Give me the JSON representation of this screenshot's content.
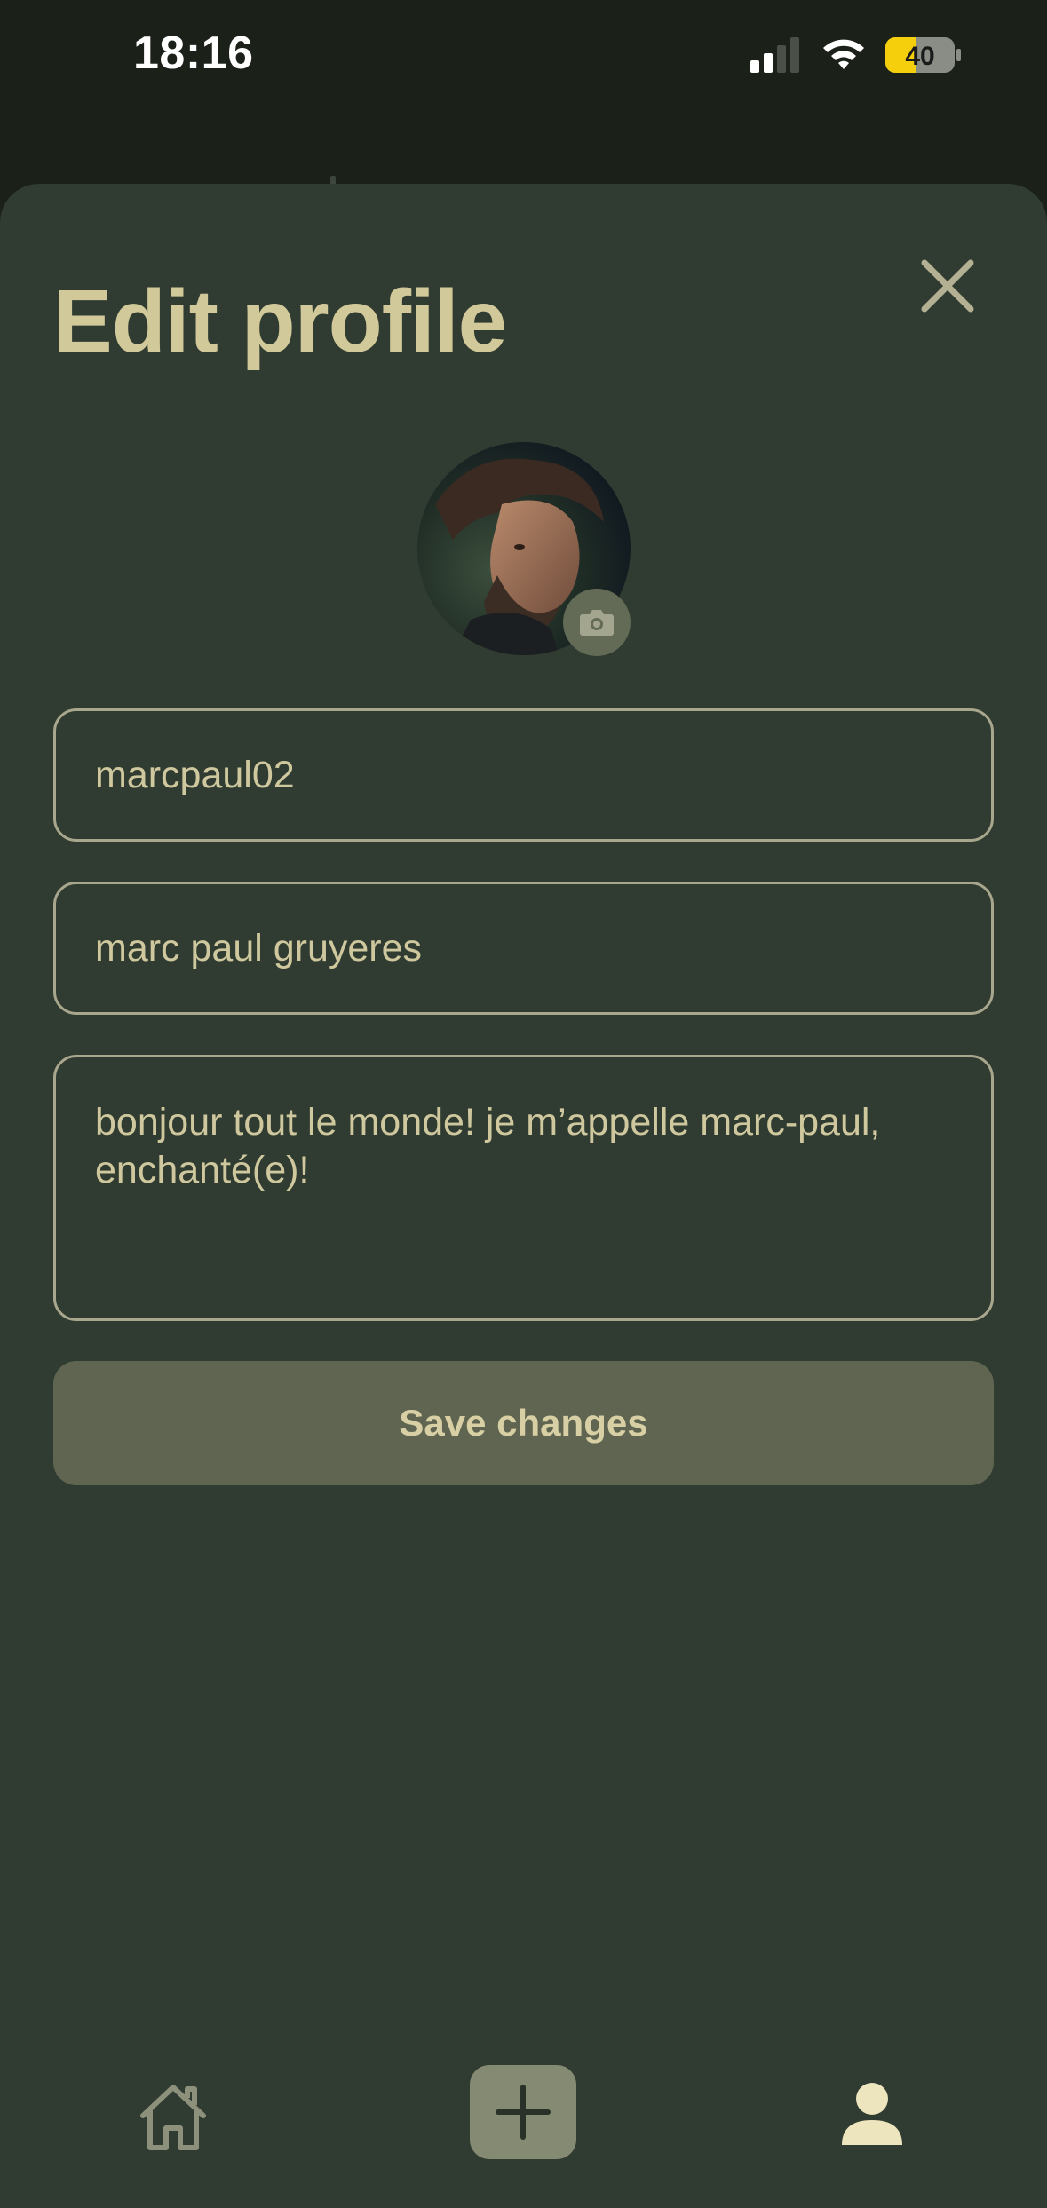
{
  "status_bar": {
    "time": "18:16",
    "battery_level": "40",
    "signal_bars_active": 2,
    "signal_bars_total": 4
  },
  "header": {
    "title": "Edit profile",
    "close_icon": "close-icon"
  },
  "avatar": {
    "badge_icon": "camera-icon"
  },
  "form": {
    "username_value": "marcpaul02",
    "name_value": "marc paul gruyeres",
    "bio_value": "bonjour tout le monde! je m’appelle marc-paul, enchanté(e)!",
    "save_label": "Save changes"
  },
  "bottom_nav": {
    "items": [
      {
        "icon": "home-icon",
        "active": false
      },
      {
        "icon": "plus-icon",
        "active": false
      },
      {
        "icon": "profile-icon",
        "active": true
      }
    ]
  },
  "colors": {
    "background": "#1b2019",
    "sheet": "#303c31",
    "accent_text": "#d2c99a",
    "field_border": "#a8a68c",
    "button_bg": "#5f6550",
    "battery_fill": "#f5cf0c"
  }
}
